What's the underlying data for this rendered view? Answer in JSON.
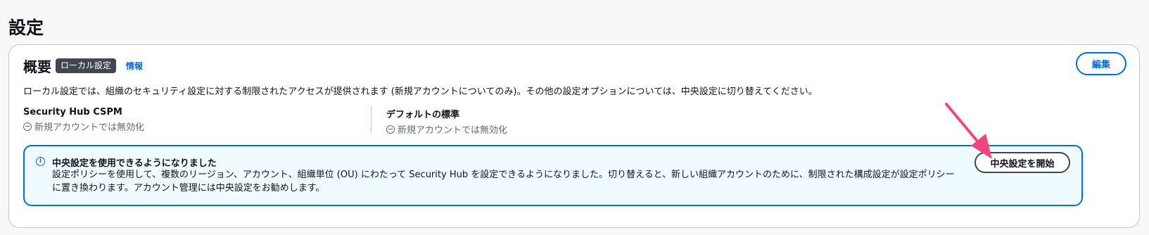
{
  "page": {
    "title": "設定"
  },
  "overview": {
    "title": "概要",
    "badge": "ローカル設定",
    "info_link": "情報",
    "edit_label": "編集",
    "description": "ローカル設定では、組織のセキュリティ設定に対する制限されたアクセスが提供されます (新規アカウントについてのみ)。その他の設定オプションについては、中央設定に切り替えてください。",
    "columns": [
      {
        "label": "Security Hub CSPM",
        "status": "新規アカウントでは無効化",
        "icon": "minus-circle-icon"
      },
      {
        "label": "デフォルトの標準",
        "status": "新規アカウントでは無効化",
        "icon": "minus-circle-icon"
      }
    ]
  },
  "alert": {
    "icon": "info-icon",
    "title": "中央設定を使用できるようになりました",
    "body": "設定ポリシーを使用して、複数のリージョン、アカウント、組織単位 (OU) にわたって Security Hub を設定できるようになりました。切り替えると、新しい組織アカウントのために、制限された構成設定が設定ポリシーに置き換わります。アカウント管理には中央設定をお勧めします。",
    "button_label": "中央設定を開始"
  },
  "colors": {
    "accent": "#006ce0",
    "alert_bg": "#f0fbff",
    "badge_bg": "#424650",
    "annotation_arrow": "#f0467f"
  }
}
